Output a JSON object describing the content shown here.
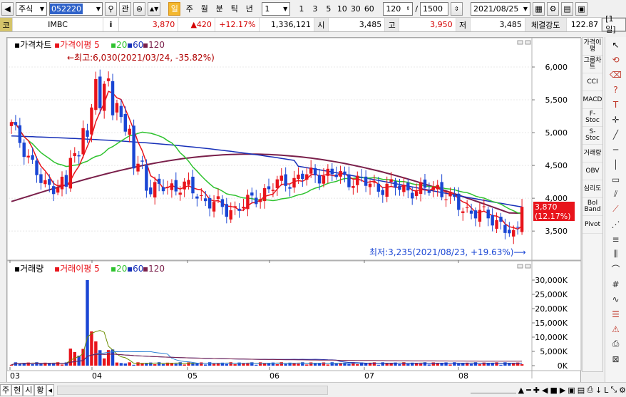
{
  "toolbar": {
    "market": "주식",
    "code": "052220",
    "search_icon": "search-icon",
    "link_label": "관",
    "periods": [
      "일",
      "주",
      "월",
      "분",
      "틱",
      "년"
    ],
    "active_period": "일",
    "interval_value": "1",
    "minute_buttons": [
      "1",
      "3",
      "5",
      "10",
      "30",
      "60"
    ],
    "count_value": "120",
    "separator": "/",
    "total_value": "1500",
    "date_value": "2021/08/25"
  },
  "quote": {
    "type_label": "코",
    "name": "IMBC",
    "info_label": "i",
    "price": "3,870",
    "change": "▲420",
    "change_pct": "+12.17%",
    "volume": "1,336,121",
    "open_label": "시",
    "open": "3,485",
    "high_label": "고",
    "high": "3,950",
    "low_label": "저",
    "low": "3,485",
    "strength_label": "체결강도",
    "strength": "122.87",
    "period_badge": "[1일]"
  },
  "price_panel": {
    "legend_title": "가격차트",
    "legend_ma_label": "가격이평",
    "legend_periods": [
      "5",
      "20",
      "60",
      "120"
    ],
    "max_annotation": "←최고:6,030(2021/03/24, -35.82%)",
    "min_annotation": "최저:3,235(2021/08/23, +19.63%)⟶",
    "last_price_label": "3,870",
    "last_pct_label": "(12.17%)",
    "y_ticks": [
      "6,000",
      "5,500",
      "5,000",
      "4,500",
      "4,000",
      "3,500"
    ]
  },
  "volume_panel": {
    "legend_title": "거래량",
    "legend_ma_label": "거래이평",
    "legend_periods": [
      "5",
      "20",
      "60",
      "120"
    ],
    "y_ticks": [
      "30,000K",
      "25,000K",
      "20,000K",
      "15,000K",
      "10,000K",
      "5,000K",
      "0K"
    ]
  },
  "x_axis": {
    "months": [
      "03",
      "04",
      "05",
      "06",
      "07",
      "08"
    ]
  },
  "indicators": [
    "가격이평",
    "그룹차트",
    "CCI",
    "MACD",
    "F-Stoc",
    "S-Stoc",
    "거래량",
    "OBV",
    "심리도",
    "Bol Band",
    "Pivot"
  ],
  "bottom_tabs": [
    "주",
    "현",
    "시",
    "황"
  ],
  "colors": {
    "up": "#e8141b",
    "down": "#1a46d4",
    "ma5": "#e8141b",
    "ma20": "#2ec22e",
    "ma60": "#1730b8",
    "ma120": "#7a1f4a",
    "last_price_box": "#e8141b",
    "accent": "#f3b72e"
  },
  "chart_data": {
    "type": "candlestick",
    "ylim": [
      3100,
      6250
    ],
    "vol_max_k": 30000,
    "ohlc_sample": [
      {
        "date": "2021/03/02",
        "o": 5050,
        "h": 5300,
        "l": 4900,
        "c": 5200
      },
      {
        "date": "2021/03/24",
        "o": 5500,
        "h": 6030,
        "l": 5300,
        "c": 5700
      },
      {
        "date": "2021/08/23",
        "o": 3400,
        "h": 3450,
        "l": 3235,
        "c": 3350
      },
      {
        "date": "2021/08/25",
        "o": 3485,
        "h": 3950,
        "l": 3485,
        "c": 3870
      }
    ]
  }
}
